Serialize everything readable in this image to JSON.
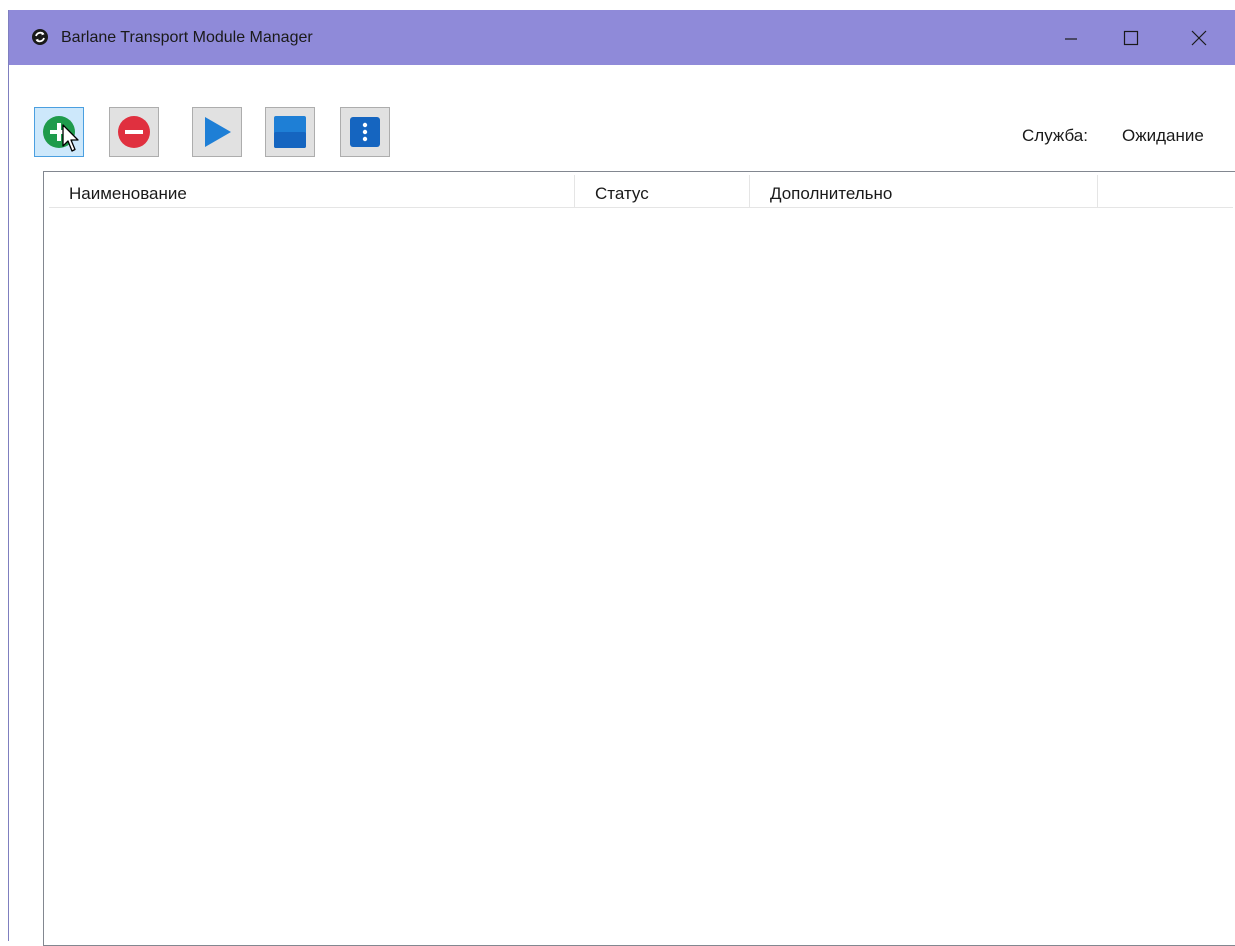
{
  "window": {
    "title": "Barlane Transport Module Manager",
    "titlebar_color": "#8f8ad9"
  },
  "toolbar": {
    "buttons": [
      {
        "name": "add-button",
        "icon": "plus-circle-icon",
        "color": "#1e9b4c"
      },
      {
        "name": "remove-button",
        "icon": "minus-circle-icon",
        "color": "#e0303f"
      },
      {
        "name": "start-button",
        "icon": "play-icon",
        "color": "#1e7fd6"
      },
      {
        "name": "stop-button",
        "icon": "stop-icon",
        "color": "#1e7fd6"
      },
      {
        "name": "more-button",
        "icon": "vertical-ellipsis-icon",
        "color": "#1565c0"
      }
    ]
  },
  "service": {
    "label": "Служба:",
    "value": "Ожидание"
  },
  "list": {
    "columns": [
      "Наименование",
      "Статус",
      "Дополнительно",
      ""
    ],
    "rows": []
  }
}
